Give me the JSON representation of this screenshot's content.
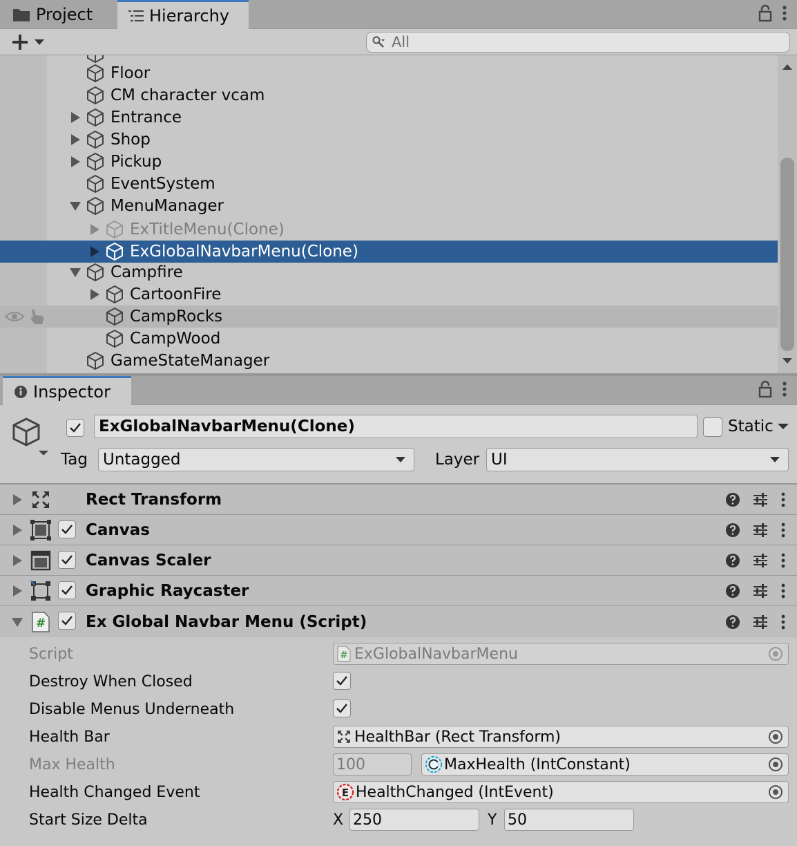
{
  "hierarchy_panel": {
    "tabs": [
      {
        "label": "Project",
        "icon": "folder-icon"
      },
      {
        "label": "Hierarchy",
        "icon": "hierarchy-list-icon"
      }
    ],
    "search_placeholder": "All",
    "items": [
      {
        "label": "Floor"
      },
      {
        "label": "CM character vcam"
      },
      {
        "label": "Entrance"
      },
      {
        "label": "Shop"
      },
      {
        "label": "Pickup"
      },
      {
        "label": "EventSystem"
      },
      {
        "label": "MenuManager"
      },
      {
        "label": "ExTitleMenu(Clone)"
      },
      {
        "label": "ExGlobalNavbarMenu(Clone)"
      },
      {
        "label": "Campfire"
      },
      {
        "label": "CartoonFire"
      },
      {
        "label": "CampRocks"
      },
      {
        "label": "CampWood"
      },
      {
        "label": "GameStateManager"
      }
    ]
  },
  "inspector": {
    "tab_label": "Inspector",
    "object_name": "ExGlobalNavbarMenu(Clone)",
    "static_label": "Static",
    "tag_label": "Tag",
    "tag_value": "Untagged",
    "layer_label": "Layer",
    "layer_value": "UI",
    "components": [
      {
        "name": "Rect Transform"
      },
      {
        "name": "Canvas"
      },
      {
        "name": "Canvas Scaler"
      },
      {
        "name": "Graphic Raycaster"
      },
      {
        "name": "Ex Global Navbar Menu (Script)"
      }
    ],
    "properties": {
      "script_label": "Script",
      "script_value": "ExGlobalNavbarMenu",
      "destroy_label": "Destroy When Closed",
      "disable_label": "Disable Menus Underneath",
      "healthbar_label": "Health Bar",
      "healthbar_value": "HealthBar (Rect Transform)",
      "maxhealth_label": "Max Health",
      "maxhealth_number": "100",
      "maxhealth_value": "MaxHealth (IntConstant)",
      "event_label": "Health Changed Event",
      "event_value": "HealthChanged (IntEvent)",
      "sizedelta_label": "Start Size Delta",
      "x_label": "X",
      "x_value": "250",
      "y_label": "Y",
      "y_value": "50"
    }
  },
  "colors": {
    "selection": "#2c5d94",
    "active_tab_accent": "#3a79bb",
    "panel_bg": "#c8c8c8"
  }
}
